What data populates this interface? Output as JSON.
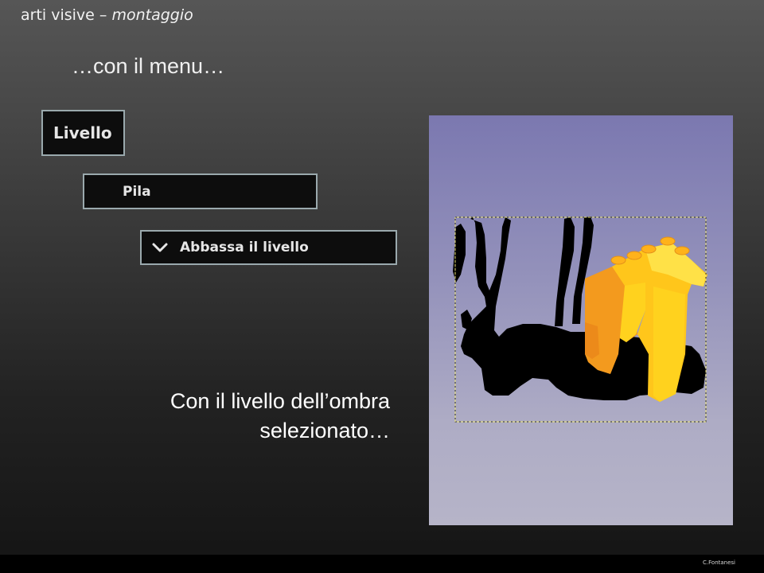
{
  "header": {
    "subject": "arti visive",
    "separator": " – ",
    "topic": "montaggio"
  },
  "slide": {
    "title": "…con il menu…"
  },
  "menu_path": {
    "level1": "Livello",
    "level2": "Pila",
    "level3": "Abbassa il livello",
    "level3_icon": "chevron-down-icon"
  },
  "caption": {
    "line1": "Con il livello dell’ombra",
    "line2": "selezionato…"
  },
  "footer": {
    "credit": "C.Fontanesi"
  },
  "colors": {
    "menu_border": "#9aa9ad",
    "menu_background": "#0d0d0d",
    "photo_background_top": "#7b78b0",
    "photo_background_bottom": "#b6b4c8",
    "lego_orange": "#f39a1e",
    "lego_yellow": "#ffd21e",
    "shadow": "#000000"
  }
}
